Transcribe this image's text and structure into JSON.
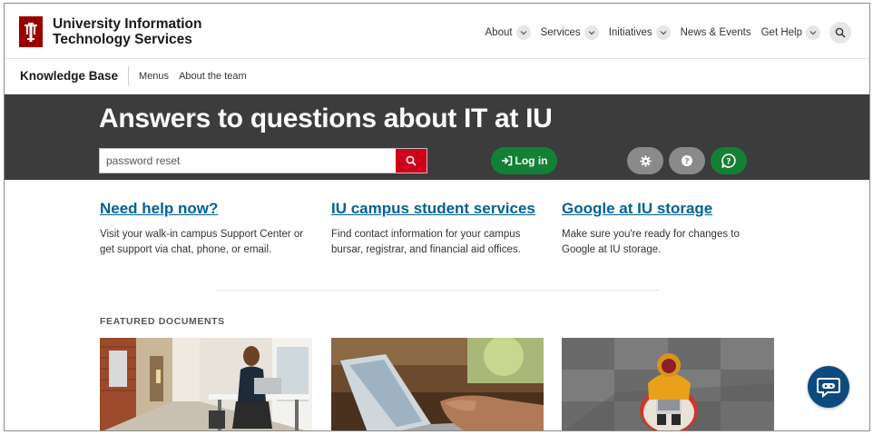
{
  "header": {
    "brand_line1": "University Information",
    "brand_line2": "Technology Services",
    "logo_icon": "iu-trident-icon",
    "nav": [
      {
        "label": "About",
        "has_dropdown": true
      },
      {
        "label": "Services",
        "has_dropdown": true
      },
      {
        "label": "Initiatives",
        "has_dropdown": true
      },
      {
        "label": "News & Events",
        "has_dropdown": false
      },
      {
        "label": "Get Help",
        "has_dropdown": true
      }
    ],
    "search_icon": "search-icon"
  },
  "subnav": {
    "title": "Knowledge Base",
    "links": [
      "Menus",
      "About the team"
    ]
  },
  "hero": {
    "title": "Answers to questions about IT at IU",
    "search_value": "password reset",
    "login_label": "Log in",
    "icons": [
      "gear-icon",
      "question-circle-icon",
      "chat-question-icon"
    ]
  },
  "promos": [
    {
      "title": "Need help now?",
      "text": "Visit your walk-in campus Support Center or get support via chat, phone, or email."
    },
    {
      "title": "IU campus student services",
      "text": "Find contact information for your campus bursar, registrar, and financial aid offices."
    },
    {
      "title": "Google at IU storage",
      "text": "Make sure you're ready for changes to Google at IU storage."
    }
  ],
  "featured": {
    "label": "FEATURED DOCUMENTS"
  },
  "colors": {
    "iu_crimson": "#990000",
    "hero_bg": "#3c3c3c",
    "search_red": "#d0021b",
    "green": "#138036",
    "link_blue": "#006298",
    "chatbot_blue": "#0d4a7e"
  }
}
